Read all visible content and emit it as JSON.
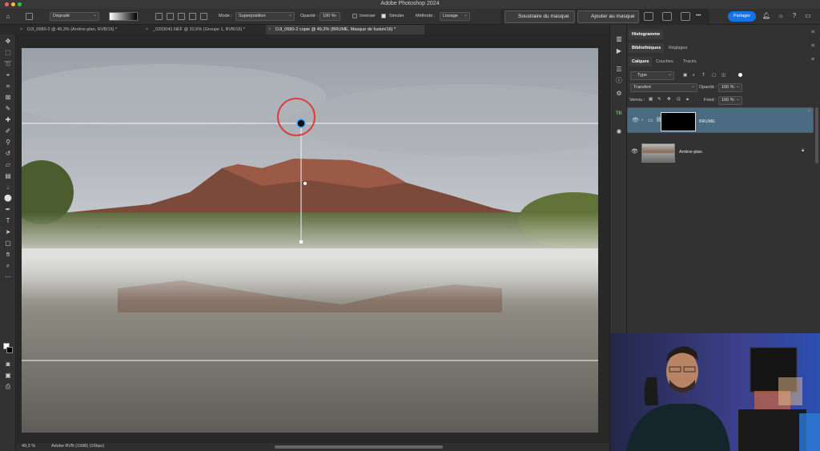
{
  "window": {
    "title": "Adobe Photoshop 2024"
  },
  "options": {
    "gradient_preset": "Dégradé",
    "mode_label": "Mode :",
    "mode_value": "Superposition",
    "opacity_label": "Opacité :",
    "opacity_value": "100 %",
    "inverser_label": "Inverser",
    "inverser_checked": false,
    "simuler_label": "Simuler",
    "simuler_checked": true,
    "methode_label": "Méthode :",
    "methode_value": "Lissage"
  },
  "mask_toolbar": {
    "subtract_label": "Soustraire du masque",
    "add_label": "Ajouter au masque",
    "more_label": "•••"
  },
  "top_right": {
    "share_label": "Partager"
  },
  "tabs": [
    {
      "label": "DJI_0680-2 @ 49,3% (Arrière-plan, RVB/16) *",
      "active": false
    },
    {
      "label": "_0293041.NEF @ 32,6% (Groupe 1, RVB/16) *",
      "active": false
    },
    {
      "label": "DJI_0680-2 copie @ 49,3% (BRUME, Masque de fusion/16) *",
      "active": true
    }
  ],
  "status": {
    "zoom": "49,3 %",
    "profile": "Adobe RVB (1998) (16bpc)"
  },
  "panels": {
    "histogram_tab": "Histogramme",
    "libraries_tab": "Bibliothèques",
    "adjustments_tab": "Réglages",
    "layers_tab": "Calques",
    "channels_tab": "Couches",
    "paths_tab": "Tracés",
    "filter_kind": "Type",
    "blend_mode": "Transfert",
    "opacity_label": "Opacité :",
    "opacity_value": "100 %",
    "lock_label": "Verrou :",
    "fill_label": "Fond :",
    "fill_value": "100 %"
  },
  "layers": [
    {
      "name": "BRUME",
      "selected": true,
      "type": "group-with-mask"
    },
    {
      "name": "Arrière-plan",
      "selected": false,
      "type": "background",
      "locked": true
    }
  ],
  "colors": {
    "accent": "#1473e6",
    "selected_layer": "#4a6b82",
    "cursor_ring": "#e23b3b"
  },
  "icons": {
    "toolbar": [
      "move-icon",
      "artboard-icon",
      "lasso-icon",
      "object-select-icon",
      "crop-icon",
      "frame-icon",
      "eyedropper-icon",
      "healing-icon",
      "brush-icon",
      "clone-stamp-icon",
      "history-brush-icon",
      "eraser-icon",
      "gradient-icon",
      "blur-icon",
      "dodge-icon",
      "pen-icon",
      "type-icon",
      "path-select-icon",
      "rectangle-icon",
      "hand-icon",
      "zoom-icon",
      "more-tools-icon"
    ]
  }
}
